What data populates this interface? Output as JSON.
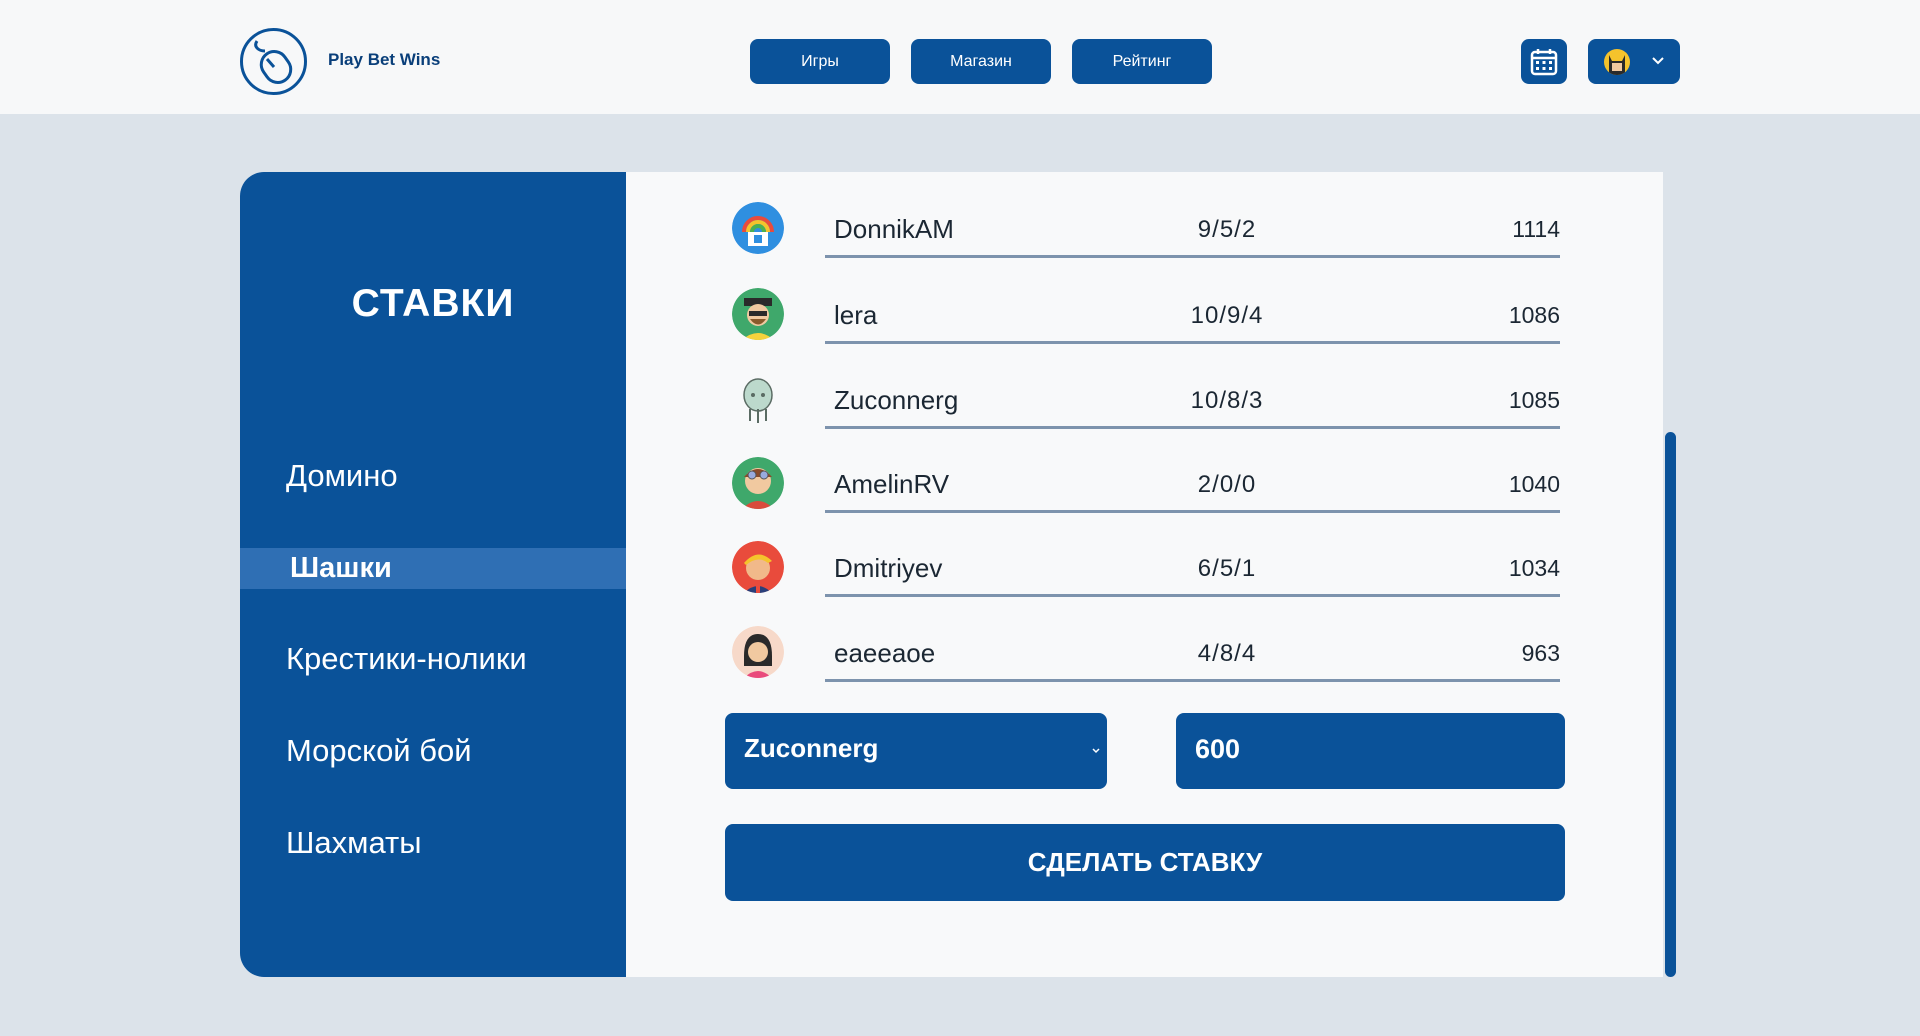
{
  "header": {
    "brand": "Play Bet Wins",
    "nav": [
      "Игры",
      "Магазин",
      "Рейтинг"
    ],
    "calendar_icon": "calendar-icon",
    "user_icon": "batman-avatar-icon"
  },
  "sidebar": {
    "title": "СТАВКИ",
    "items": [
      "Домино",
      "Шашки",
      "Крестики-нолики",
      "Морской бой",
      "Шахматы"
    ],
    "active_index": 1
  },
  "ranking": [
    {
      "name": "DonnikAM",
      "score": "9/5/2",
      "points": "1114"
    },
    {
      "name": "lera",
      "score": "10/9/4",
      "points": "1086"
    },
    {
      "name": "Zuconnerg",
      "score": "10/8/3",
      "points": "1085"
    },
    {
      "name": "AmelinRV",
      "score": "2/0/0",
      "points": "1040"
    },
    {
      "name": "Dmitriyev",
      "score": "6/5/1",
      "points": "1034"
    },
    {
      "name": "eaeeaoe",
      "score": "4/8/4",
      "points": "963"
    }
  ],
  "bet_form": {
    "selected_player": "Zuconnerg",
    "amount": "600",
    "submit_label": "СДЕЛАТЬ СТАВКУ"
  },
  "colors": {
    "primary": "#0a5299",
    "active_item": "#2f6fb4",
    "background": "#dce3ea"
  }
}
